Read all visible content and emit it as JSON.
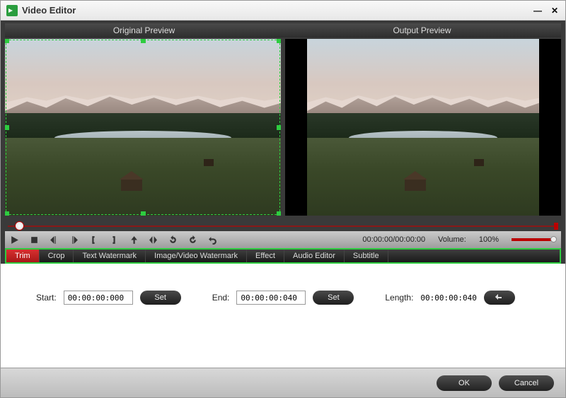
{
  "window": {
    "title": "Video Editor"
  },
  "previews": {
    "original_label": "Original Preview",
    "output_label": "Output Preview"
  },
  "playback": {
    "time_display": "00:00:00/00:00:00",
    "volume_label": "Volume:",
    "volume_value": "100%"
  },
  "tabs": [
    "Trim",
    "Crop",
    "Text Watermark",
    "Image/Video Watermark",
    "Effect",
    "Audio Editor",
    "Subtitle"
  ],
  "trim": {
    "start_label": "Start:",
    "start_value": "00:00:00:000",
    "end_label": "End:",
    "end_value": "00:00:00:040",
    "set_label": "Set",
    "length_label": "Length:",
    "length_value": "00:00:00:040"
  },
  "footer": {
    "ok": "OK",
    "cancel": "Cancel"
  }
}
